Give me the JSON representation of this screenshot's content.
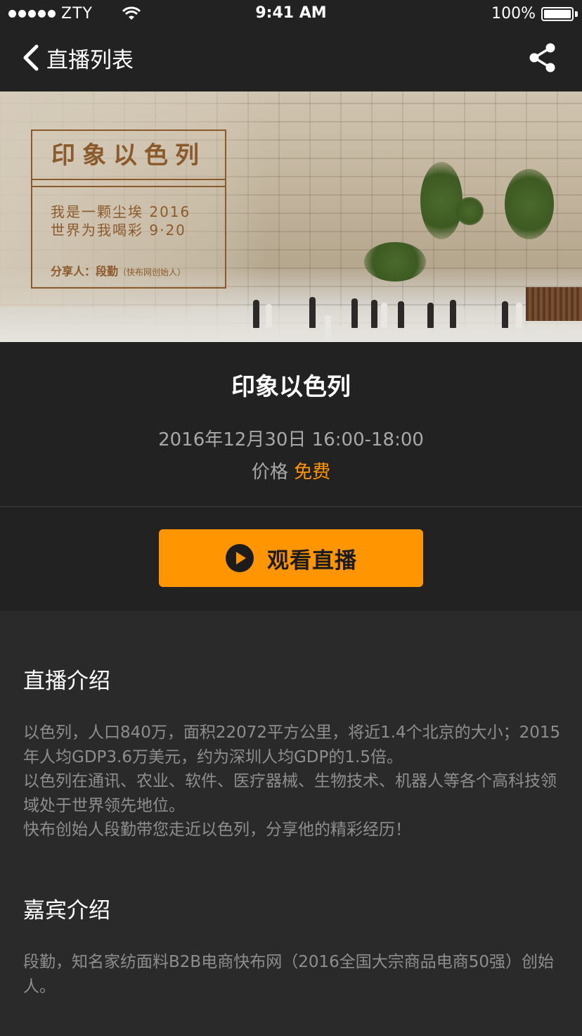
{
  "status_bar": {
    "carrier": "ZTY",
    "time": "9:41 AM",
    "battery": "100%"
  },
  "nav": {
    "back_icon": "chevron-left-icon",
    "title": "直播列表",
    "share_icon": "share-icon"
  },
  "banner": {
    "poster_title": "印象以色列",
    "poster_line1": "我是一颗尘埃 2016",
    "poster_line2": "世界为我喝彩 9·20",
    "poster_sharer": "分享人：段勤",
    "poster_sharer_note": "（快布网创始人）"
  },
  "event": {
    "title": "印象以色列",
    "time": "2016年12月30日 16:00-18:00",
    "price_label": "价格",
    "price_value": "免费"
  },
  "cta": {
    "icon": "play-circle-icon",
    "label": "观看直播"
  },
  "intro": {
    "title": "直播介绍",
    "paragraphs": [
      "以色列，人口840万，面积22072平方公里，将近1.4个北京的大小；2015年人均GDP3.6万美元，约为深圳人均GDP的1.5倍。",
      "以色列在通讯、农业、软件、医疗器械、生物技术、机器人等各个高科技领域处于世界领先地位。",
      "快布创始人段勤带您走近以色列，分享他的精彩经历！"
    ]
  },
  "guest": {
    "title": "嘉宾介绍",
    "body": "段勤，知名家纺面料B2B电商快布网（2016全国大宗商品电商50强）创始人。"
  },
  "colors": {
    "accent": "#ff9500",
    "background": "#2a2a2a",
    "header_bg": "#222222"
  }
}
